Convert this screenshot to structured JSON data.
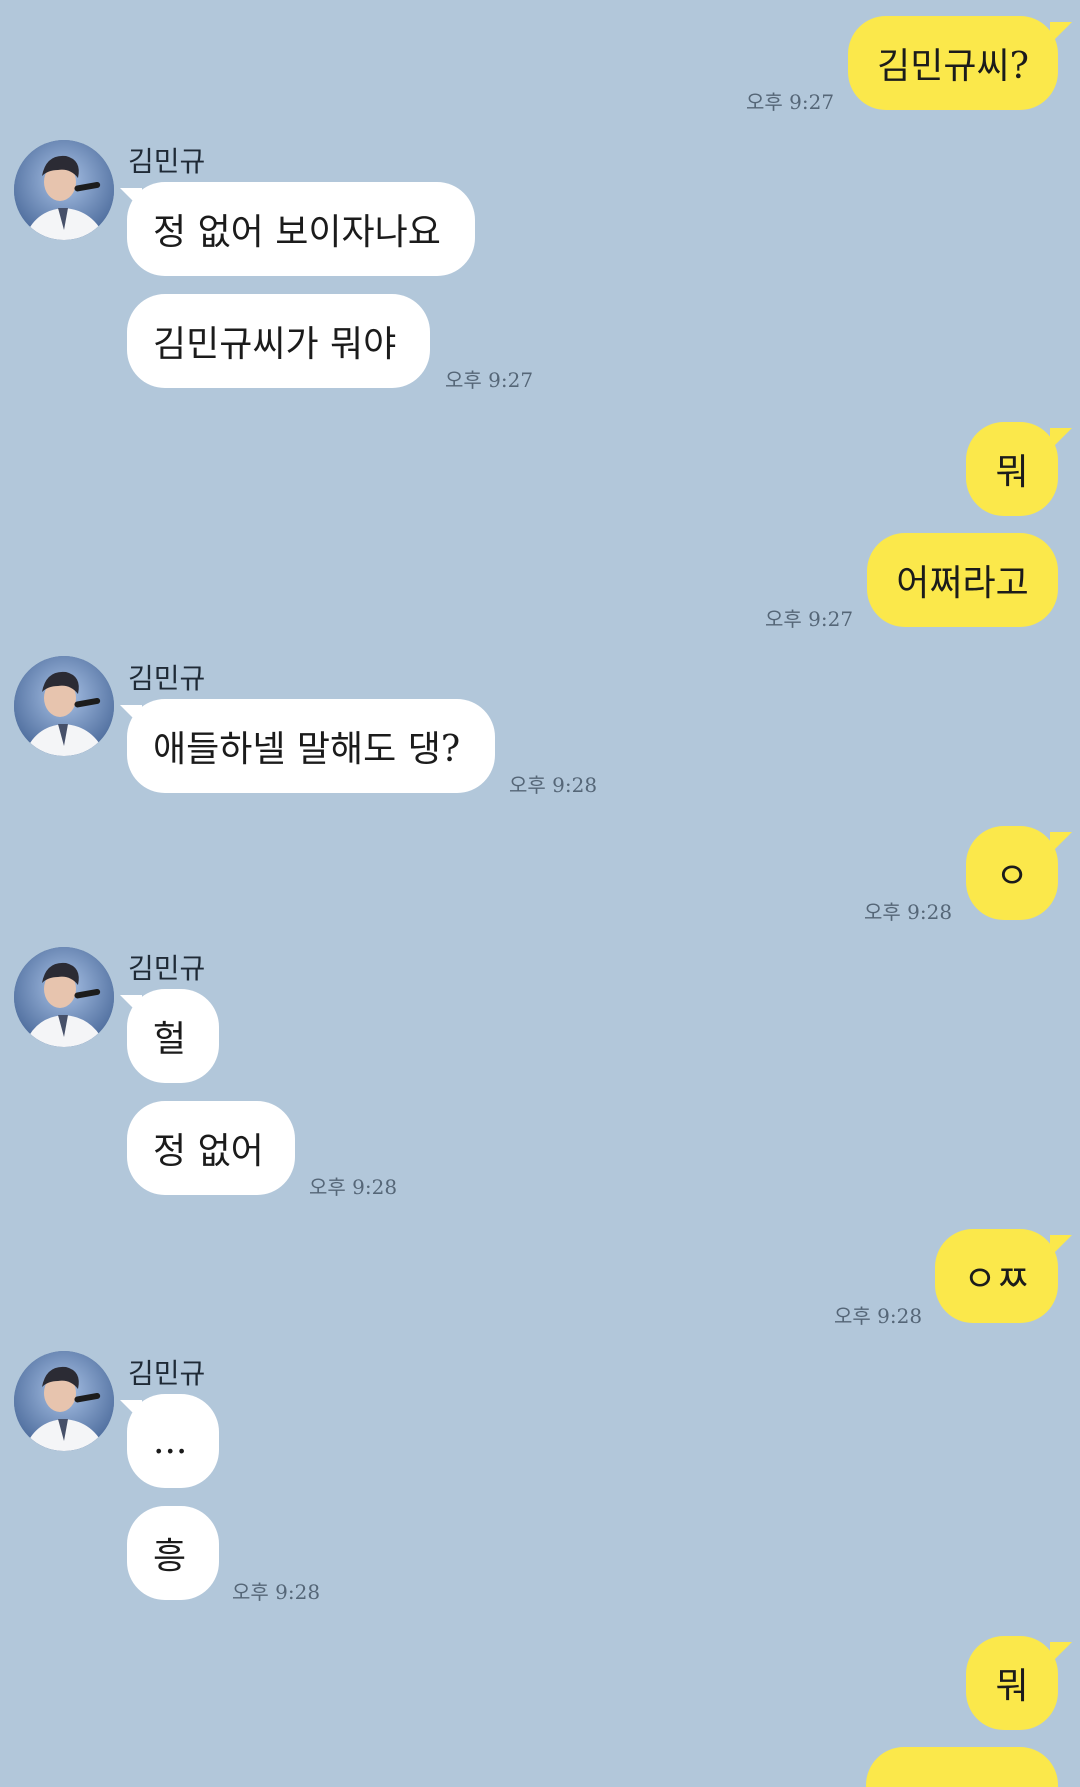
{
  "sender": {
    "name": "김민규"
  },
  "colors": {
    "background": "#b2c7da",
    "outgoing_bubble": "#fbe84b",
    "incoming_bubble": "#ffffff"
  },
  "messages": [
    {
      "dir": "out",
      "text": "김민규씨?",
      "time": "오후 9:27"
    },
    {
      "dir": "in",
      "text": "정 없어 보이자나요",
      "time": ""
    },
    {
      "dir": "in",
      "text": "김민규씨가 뭐야",
      "time": "오후 9:27"
    },
    {
      "dir": "out",
      "text": "뭐",
      "time": ""
    },
    {
      "dir": "out",
      "text": "어쩌라고",
      "time": "오후 9:27"
    },
    {
      "dir": "in",
      "text": "애들하넬 말해도 댕?",
      "time": "오후 9:28"
    },
    {
      "dir": "out",
      "text": "ㅇ",
      "time": "오후 9:28"
    },
    {
      "dir": "in",
      "text": "헐",
      "time": ""
    },
    {
      "dir": "in",
      "text": "정 없어",
      "time": "오후 9:28"
    },
    {
      "dir": "out",
      "text": "ㅇㅉ",
      "time": "오후 9:28"
    },
    {
      "dir": "in",
      "text": "...",
      "time": ""
    },
    {
      "dir": "in",
      "text": "흥",
      "time": "오후 9:28"
    },
    {
      "dir": "out",
      "text": "뭐",
      "time": ""
    }
  ]
}
